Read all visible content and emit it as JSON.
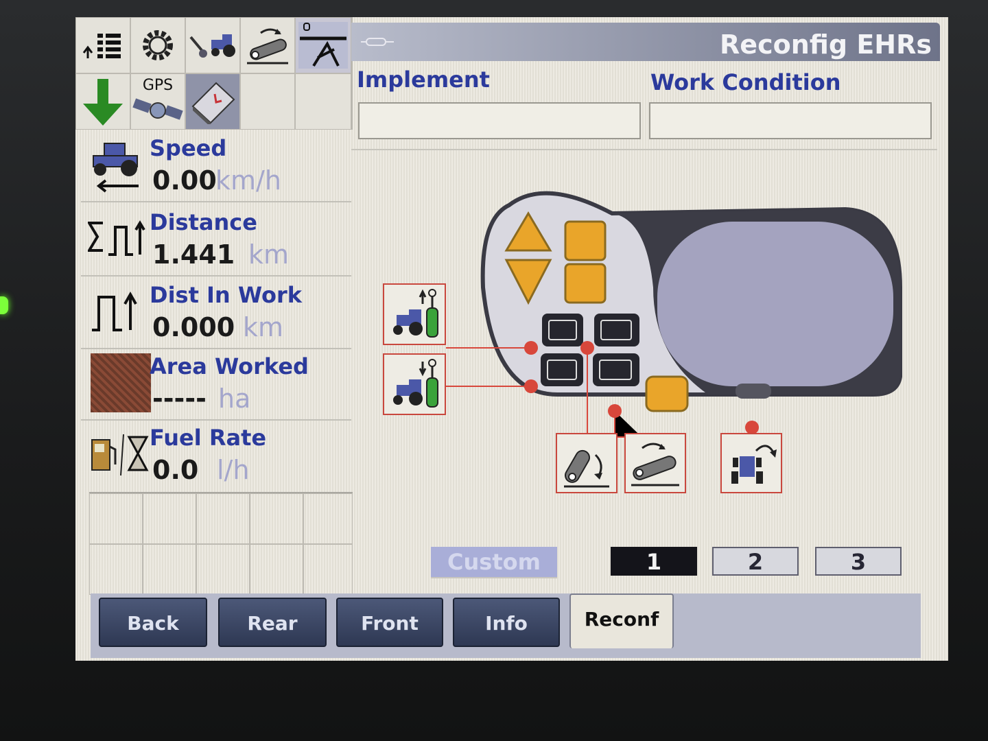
{
  "header": {
    "title": "Reconfig EHRs"
  },
  "fields": {
    "implement_label": "Implement",
    "implement_value": "",
    "work_condition_label": "Work Condition",
    "work_condition_value": ""
  },
  "top_icons": {
    "gps_label": "GPS"
  },
  "metrics": [
    {
      "label": "Speed",
      "value": "0.00",
      "unit": "km/h"
    },
    {
      "label": "Distance",
      "value": "1.441",
      "unit": "km"
    },
    {
      "label": "Dist In Work",
      "value": "0.000",
      "unit": "km"
    },
    {
      "label": "Area Worked",
      "value": "-----",
      "unit": "ha"
    },
    {
      "label": "Fuel Rate",
      "value": "0.0",
      "unit": "l/h"
    }
  ],
  "mode": {
    "custom_label": "Custom",
    "options": [
      "1",
      "2",
      "3"
    ],
    "selected": "1"
  },
  "tabs": [
    {
      "label": "Back"
    },
    {
      "label": "Rear"
    },
    {
      "label": "Front"
    },
    {
      "label": "Info"
    },
    {
      "label": "Reconf",
      "active": true
    }
  ],
  "colors": {
    "accent_blue": "#2b3a9c",
    "header_gray": "#6e7389",
    "orange": "#e9a52a",
    "connector_red": "#d8473b"
  }
}
